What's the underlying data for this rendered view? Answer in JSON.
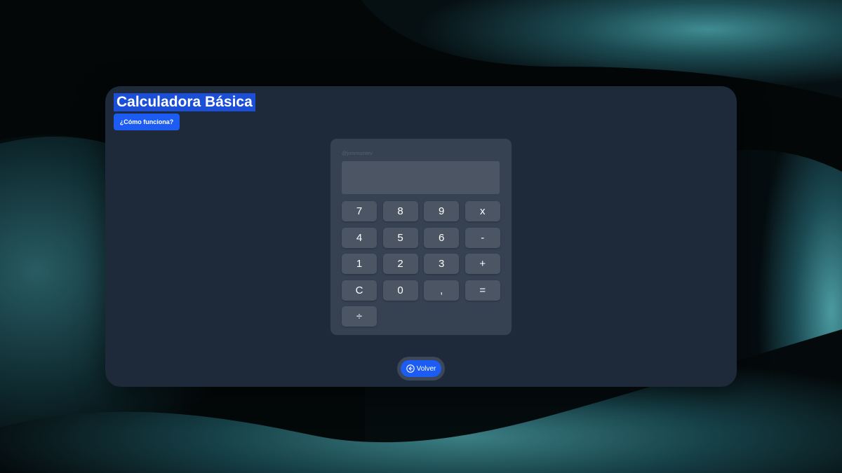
{
  "app": {
    "title": "Calculadora Básica",
    "help_label": "¿Cómo funciona?"
  },
  "calculator": {
    "handle": "@jonimontev",
    "display_value": "",
    "keys": {
      "k7": "7",
      "k8": "8",
      "k9": "9",
      "multiply": "x",
      "k4": "4",
      "k5": "5",
      "k6": "6",
      "subtract": "-",
      "k1": "1",
      "k2": "2",
      "k3": "3",
      "add": "+",
      "clear": "C",
      "k0": "0",
      "decimal": ",",
      "equals": "=",
      "divide": "÷"
    }
  },
  "nav": {
    "back_label": "Volver",
    "back_icon": "arrow-left-circle-icon"
  },
  "colors": {
    "accent": "#1c5cf2",
    "panel": "#1e2939",
    "calculator_body": "#364152",
    "key": "#4b5563"
  }
}
